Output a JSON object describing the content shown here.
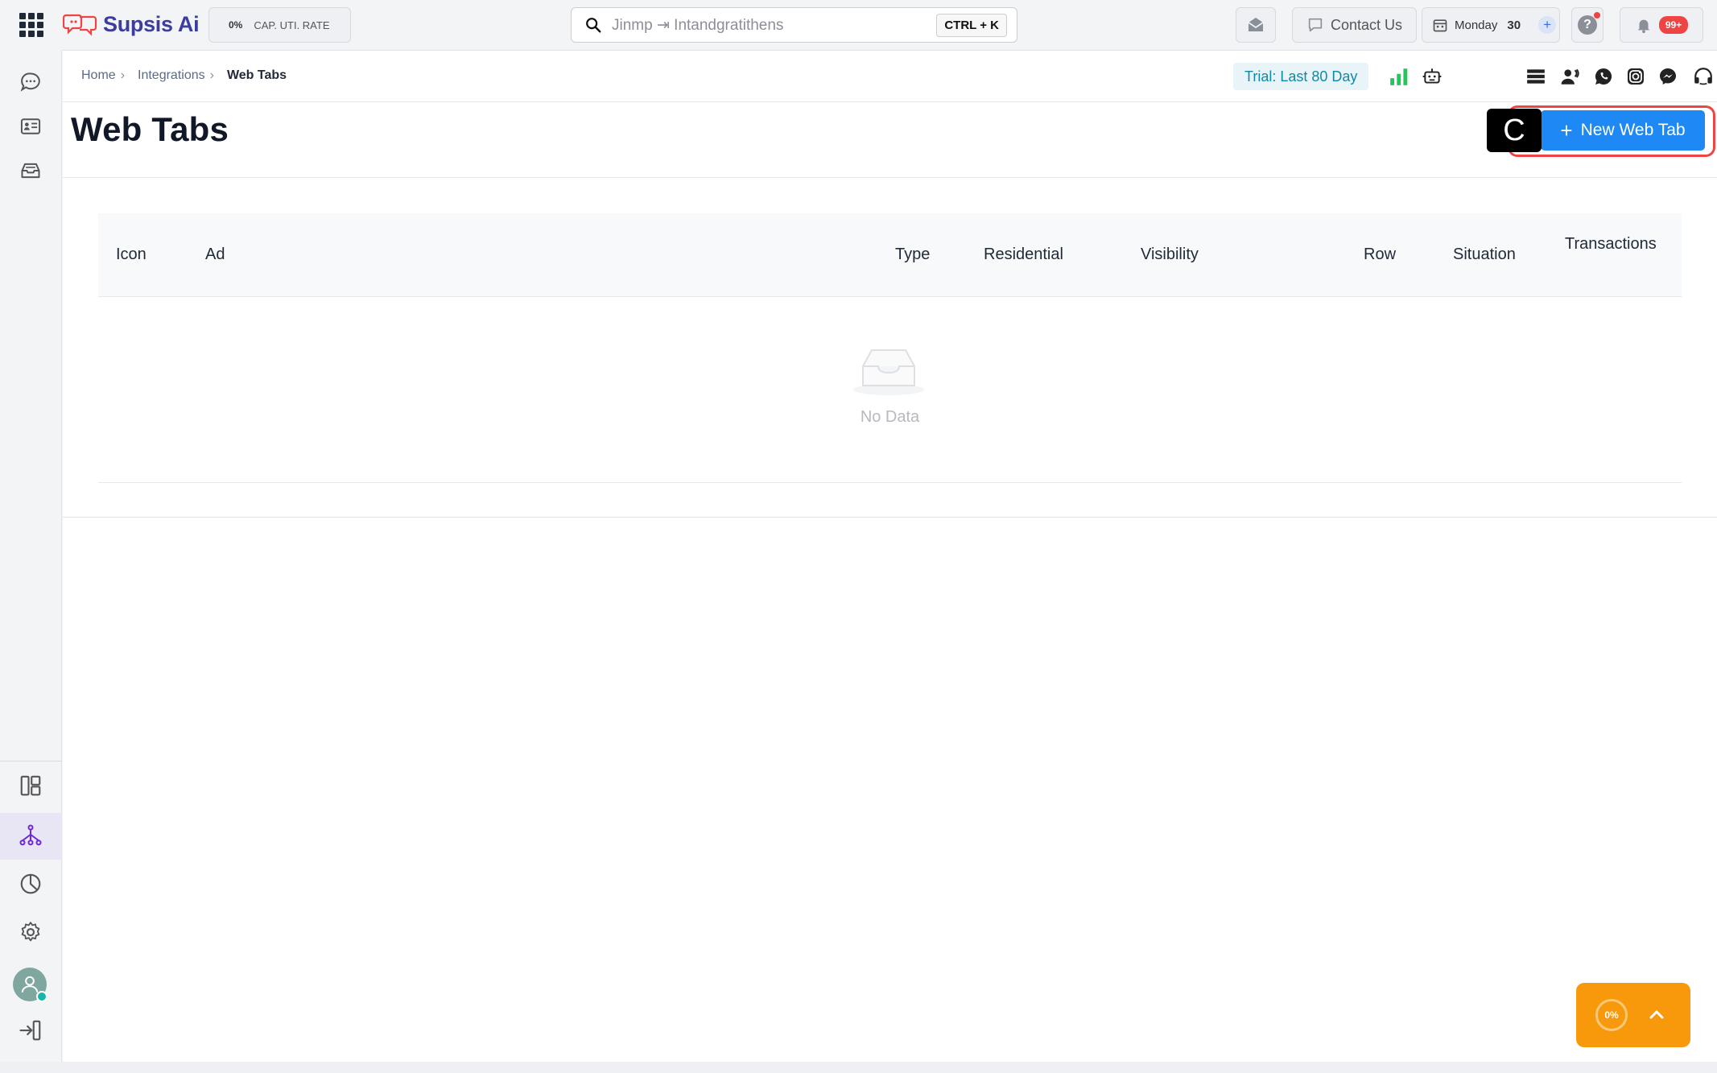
{
  "app": {
    "name": "Supsis Ai",
    "rate": {
      "value": "0%",
      "label": "CAP. UTI. RATE"
    }
  },
  "search": {
    "placeholder": "Jinmp ⇥ Intandgratithens",
    "shortcut": "CTRL + K"
  },
  "topbar": {
    "contact_label": "Contact Us",
    "date_day": "Monday",
    "date_num": "30",
    "help_label": "?",
    "notifications_badge": "99+"
  },
  "breadcrumb": {
    "items": [
      "Home",
      "Integrations",
      "Web Tabs"
    ]
  },
  "trial_label": "Trial: Last 80 Day",
  "page": {
    "title": "Web Tabs",
    "new_button_label": "New Web Tab",
    "hint_key": "C"
  },
  "table": {
    "columns": [
      "Icon",
      "Ad",
      "Type",
      "Residential",
      "Visibility",
      "Row",
      "Situation",
      "Transactions"
    ],
    "rows": [],
    "empty_text": "No Data"
  },
  "fab": {
    "progress_text": "0%"
  },
  "colors": {
    "primary": "#1e88f5",
    "brand": "#3d3d9e",
    "accent_orange": "#f7990b",
    "danger": "#ef4444",
    "trial_text": "#0f8aa8"
  },
  "icons": {
    "sidebar_top": [
      "chat-icon",
      "contact-card-icon",
      "inbox-icon"
    ],
    "sidebar_bottom": [
      "dashboard-icon",
      "integrations-icon",
      "reports-icon",
      "settings-icon",
      "logout-icon"
    ],
    "toolbar": [
      "signal-bars-icon",
      "bot-icon",
      "list-icon",
      "team-icon",
      "whatsapp-icon",
      "instagram-icon",
      "messenger-icon",
      "headset-icon",
      "window-icon"
    ]
  }
}
